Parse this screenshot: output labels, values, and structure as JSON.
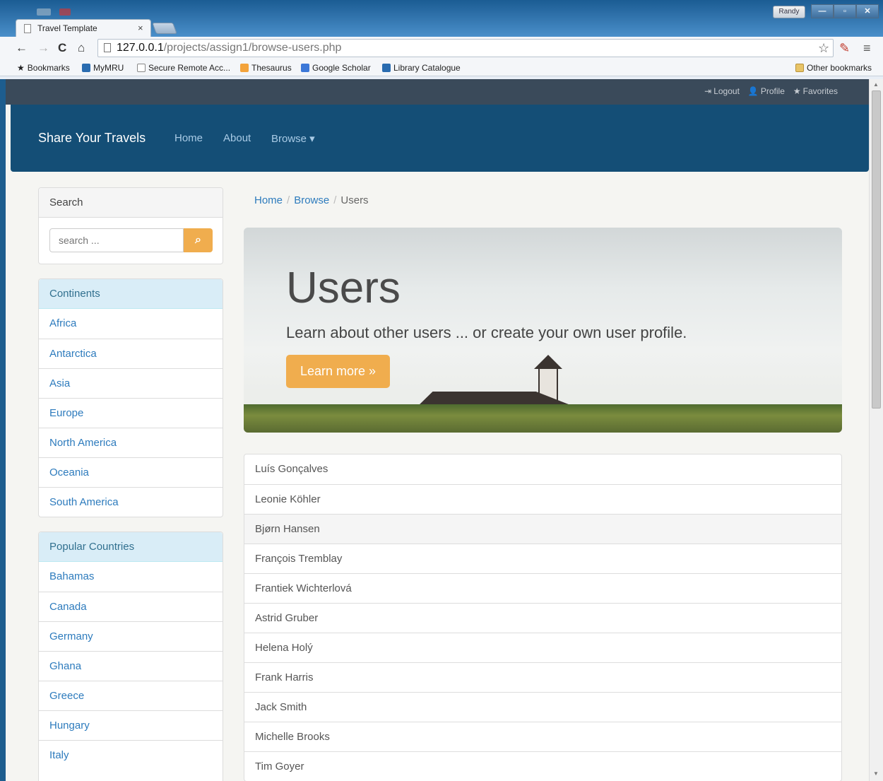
{
  "browser": {
    "tab_title": "Travel Template",
    "tab_close": "×",
    "user_badge": "Randy",
    "url_host": "127.0.0.1",
    "url_path": "/projects/assign1/browse-users.php",
    "bookmarks": [
      {
        "label": "Bookmarks",
        "icon": "star-icon"
      },
      {
        "label": "MyMRU",
        "icon": "mru-icon"
      },
      {
        "label": "Secure Remote Acc...",
        "icon": "page-icon"
      },
      {
        "label": "Thesaurus",
        "icon": "thesaurus-icon"
      },
      {
        "label": "Google Scholar",
        "icon": "scholar-icon"
      },
      {
        "label": "Library Catalogue",
        "icon": "mru-icon"
      }
    ],
    "other_bookmarks": "Other bookmarks"
  },
  "top_links": {
    "logout": "Logout",
    "profile": "Profile",
    "favorites": "Favorites"
  },
  "navbar": {
    "brand": "Share Your Travels",
    "home": "Home",
    "about": "About",
    "browse": "Browse ▾"
  },
  "search": {
    "heading": "Search",
    "placeholder": "search ..."
  },
  "continents": {
    "heading": "Continents",
    "items": [
      "Africa",
      "Antarctica",
      "Asia",
      "Europe",
      "North America",
      "Oceania",
      "South America"
    ]
  },
  "countries": {
    "heading": "Popular Countries",
    "items": [
      "Bahamas",
      "Canada",
      "Germany",
      "Ghana",
      "Greece",
      "Hungary",
      "Italy"
    ]
  },
  "breadcrumb": {
    "home": "Home",
    "browse": "Browse",
    "current": "Users"
  },
  "jumbotron": {
    "title": "Users",
    "subtitle": "Learn about other users ... or create your own user profile.",
    "button": "Learn more »"
  },
  "users": [
    "Luís Gonçalves",
    "Leonie Köhler",
    "Bjørn Hansen",
    "François Tremblay",
    "Frantiek Wichterlová",
    "Astrid Gruber",
    "Helena Holý",
    "Frank Harris",
    "Jack Smith",
    "Michelle Brooks",
    "Tim Goyer"
  ],
  "colors": {
    "navbar": "#144e76",
    "link": "#2d7bbd",
    "warning": "#f0ad4e"
  }
}
